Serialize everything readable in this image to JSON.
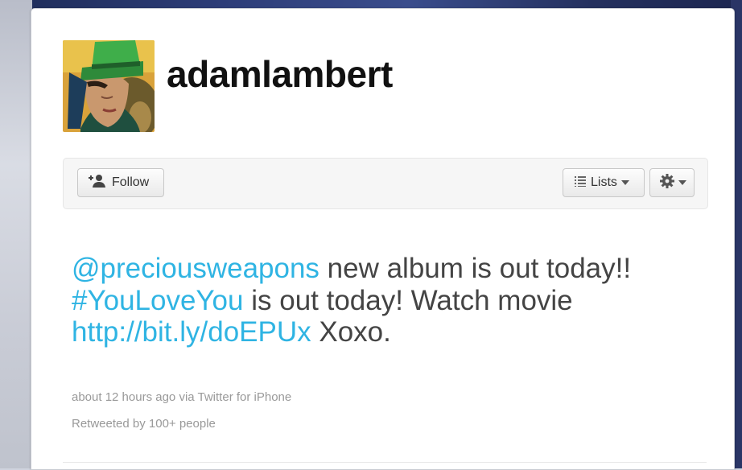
{
  "profile": {
    "username": "adamlambert"
  },
  "actions": {
    "follow_label": "Follow",
    "lists_label": "Lists"
  },
  "icons": {
    "follow": "add-user-icon",
    "lists": "list-icon",
    "settings": "gear-icon",
    "dropdown": "caret-down-icon"
  },
  "tweet": {
    "mention": "@preciousweapons",
    "text1": " new album is out today!! ",
    "hashtag": "#YouLoveYou",
    "text2": " is out today! Watch movie ",
    "url": "http://bit.ly/doEPUx",
    "text3": " Xoxo.",
    "timestamp": "about 12 hours ago via Twitter for iPhone",
    "retweet_info": "Retweeted by 100+ people"
  },
  "colors": {
    "link": "#2fb4e3",
    "text": "#444444",
    "meta": "#999999"
  }
}
